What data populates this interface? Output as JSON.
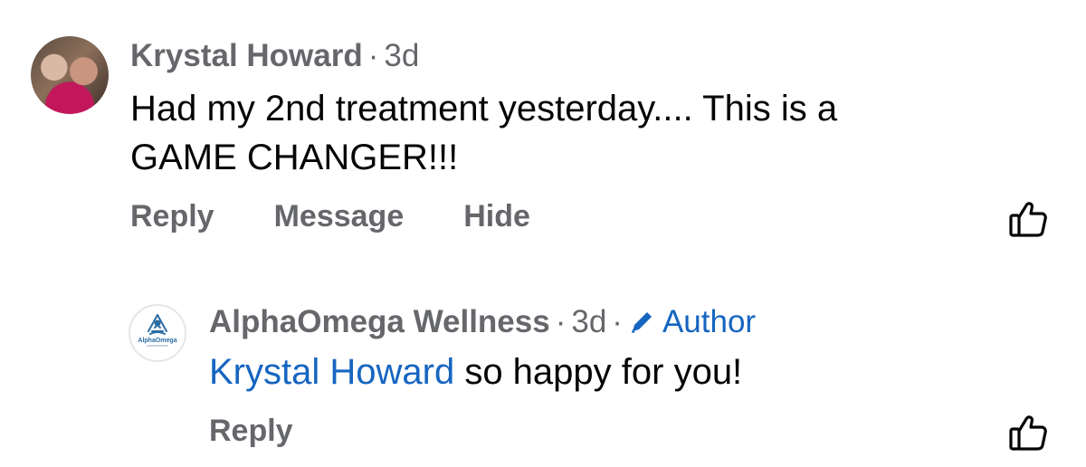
{
  "comments": [
    {
      "author": "Krystal Howard",
      "time": "3d",
      "text_line1": "Had my 2nd treatment yesterday.... This is a",
      "text_line2": "GAME CHANGER!!!",
      "actions": [
        "Reply",
        "Message",
        "Hide"
      ],
      "like_icon": "thumbs-up-outline-icon"
    }
  ],
  "reply": {
    "author": "AlphaOmega Wellness",
    "time": "3d",
    "author_badge": "Author",
    "badge_icon": "pencil-icon",
    "mention": "Krystal Howard",
    "text": " so happy for you!",
    "actions": [
      "Reply"
    ],
    "logo_text": "AlphaOmega",
    "like_icon": "thumbs-up-outline-icon"
  },
  "colors": {
    "secondary_text": "#65676b",
    "link_blue": "#1665c0",
    "body_text": "#050505"
  }
}
